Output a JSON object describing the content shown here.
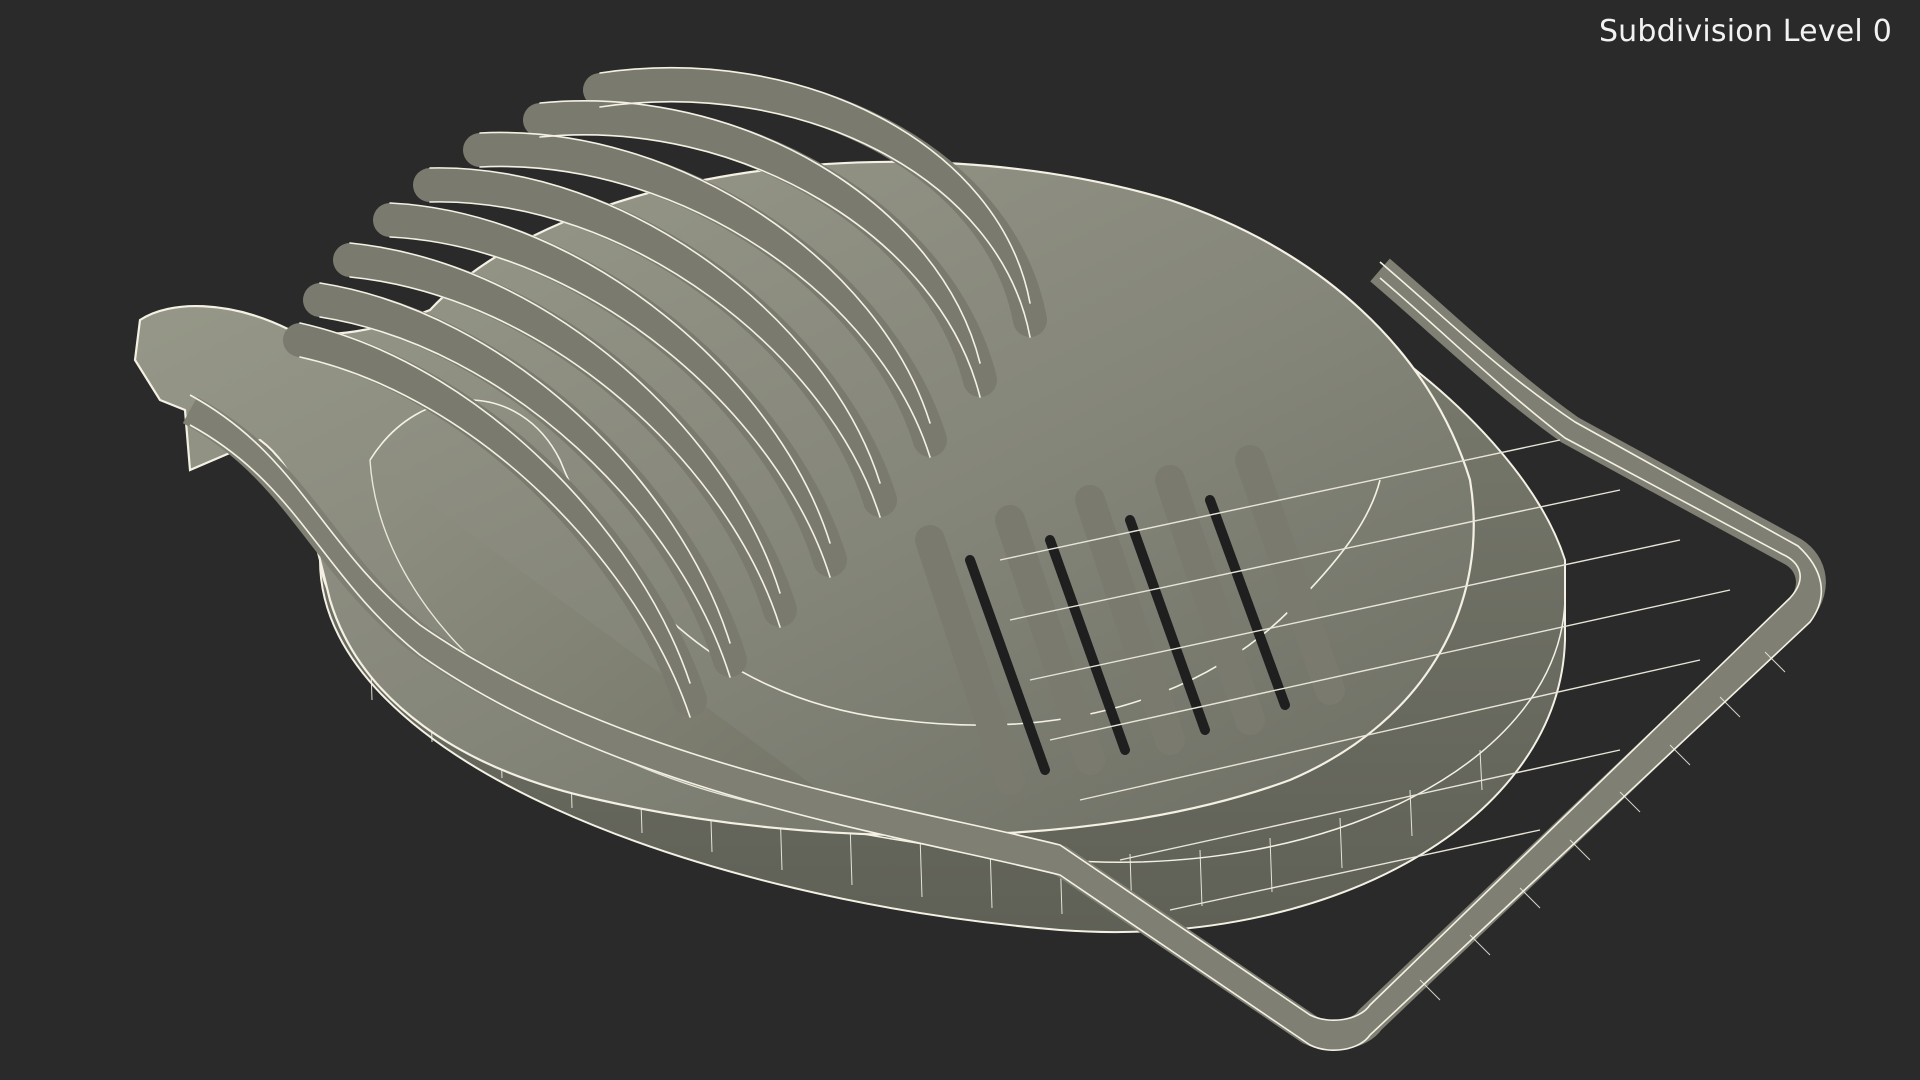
{
  "viewport": {
    "caption": "Subdivision Level 0",
    "render_mode": "wireframe-on-shaded",
    "background_color": "#2a2a2a",
    "surface_color": "#8a8b7c",
    "wire_color": "#f4f1e4",
    "subject": "egg-slicer-3d-model",
    "icons": [
      "cradle-icon",
      "wire-frame-icon"
    ]
  }
}
